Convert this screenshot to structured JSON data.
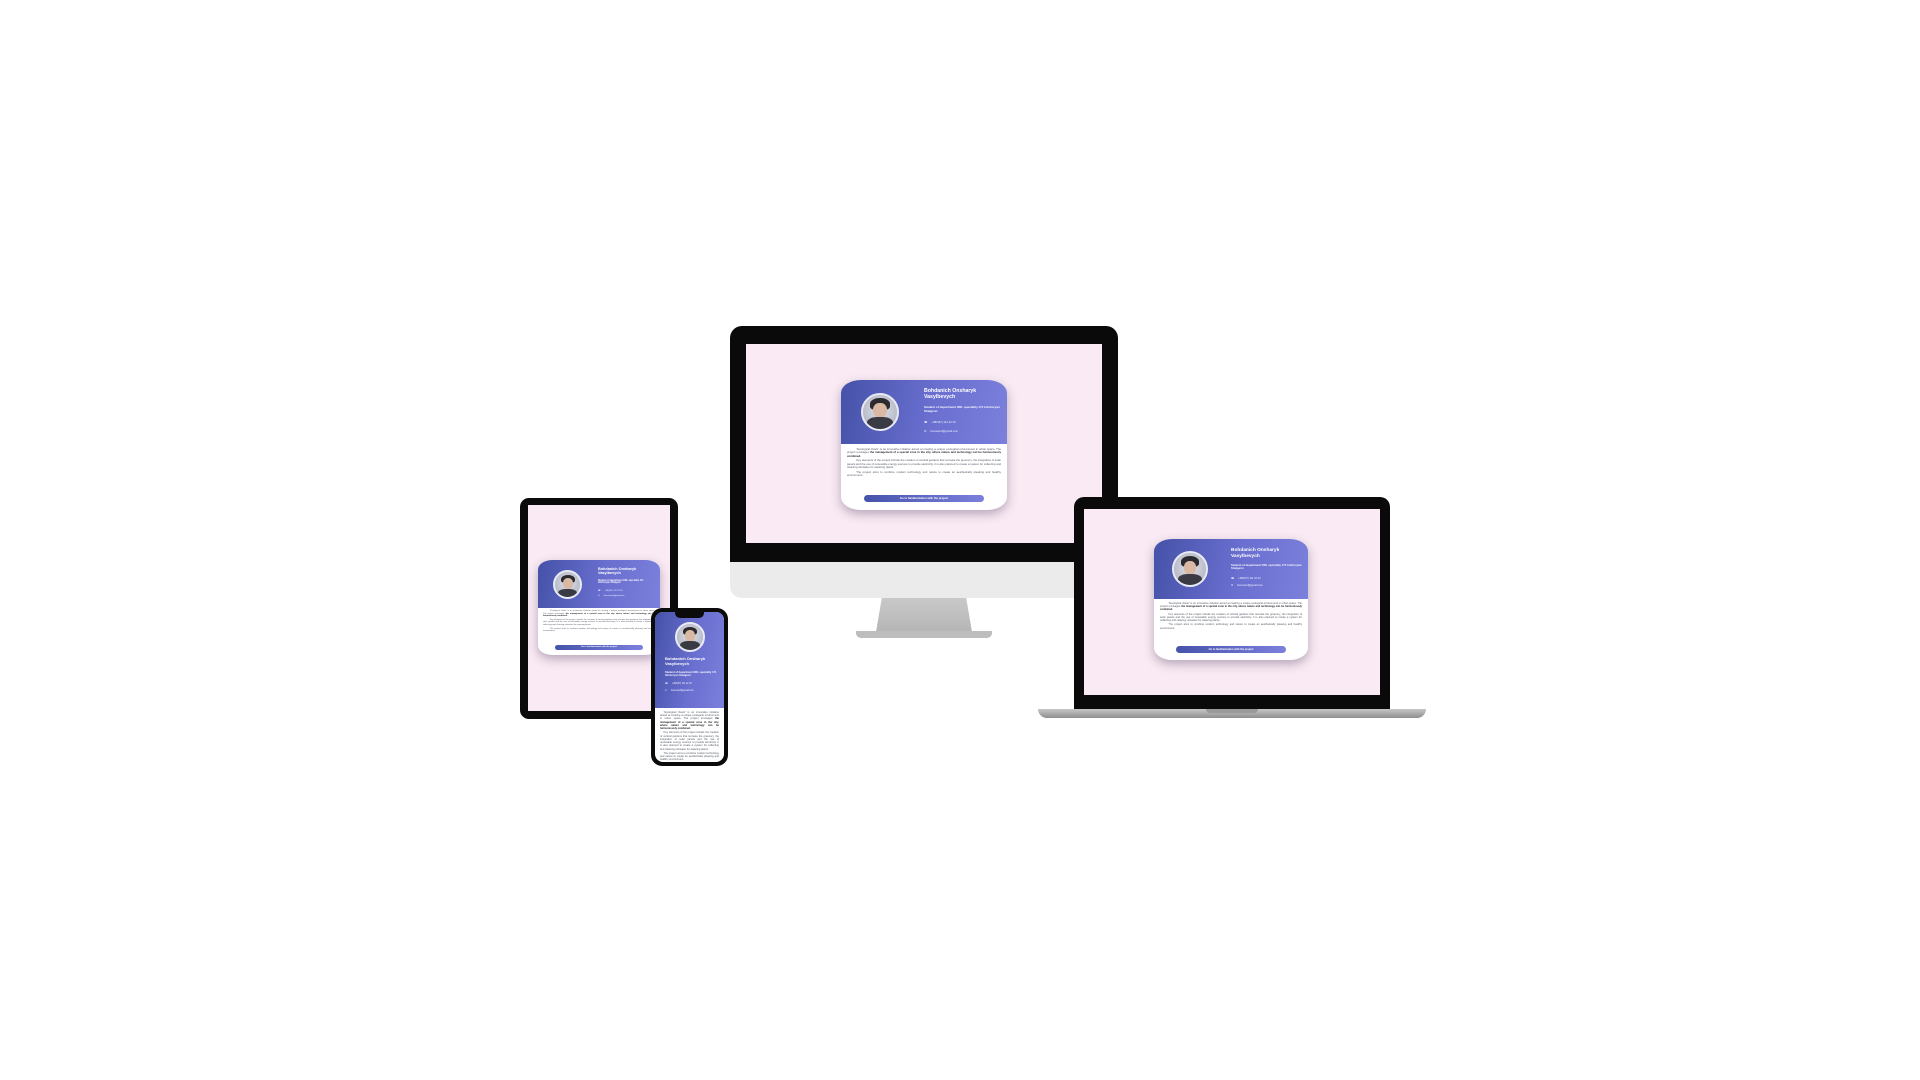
{
  "profile": {
    "name": "Bohdanich Onsharyk Vasylbevych",
    "position": "Student of department ORL speciality 171 Infohoryan Shalgenn",
    "phone": "+380(67) 111 22 33",
    "email": "bosuvand@gmail.com",
    "description": [
      "\"Ecological Oasis\" is an innovative initiative aimed at creating a unique ecological environment in urban space. The project envisages",
      "the management of a special zone in the city, where nature and technology can be harmoniously combined.",
      "Key elements of the project include the creation of vertical gardens that recreate the greenery, the integration of solar panels and the use of renewable energy sources to provide electricity. It is also planned to create a system for collecting and cleaning rainwater for watering plants.",
      "The project aims to combine modern technology and nature to create an aesthetically pleasing and healthy environment."
    ],
    "cta_label": "Go to familiarization with the project"
  },
  "icons": {
    "phone": "phone-icon",
    "email": "email-icon",
    "avatar": "avatar-photo"
  },
  "colors": {
    "page_background": "#ffffff",
    "screen_background": "#f9eaf3",
    "gradient_start": "#4552a8",
    "gradient_end": "#7b80dc",
    "device_frame": "#0a0a0a"
  }
}
